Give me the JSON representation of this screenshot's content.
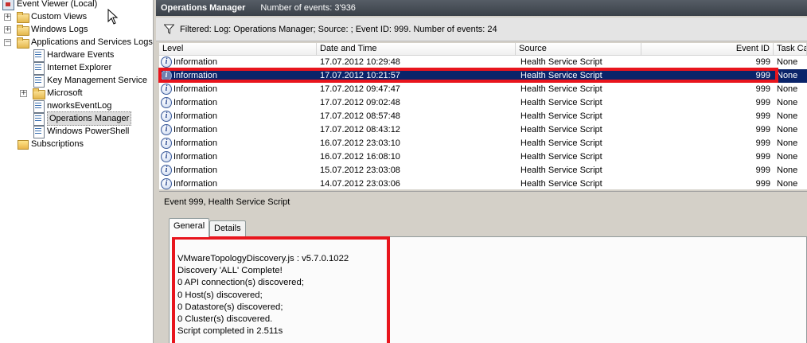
{
  "tree": {
    "root": "Event Viewer (Local)",
    "items": [
      {
        "label": "Custom Views",
        "icon": "folder-icon"
      },
      {
        "label": "Windows Logs",
        "icon": "folder-icon"
      },
      {
        "label": "Applications and Services Logs",
        "icon": "folder-icon"
      },
      {
        "label": "Hardware Events",
        "icon": "log-icon"
      },
      {
        "label": "Internet Explorer",
        "icon": "log-icon"
      },
      {
        "label": "Key Management Service",
        "icon": "log-icon"
      },
      {
        "label": "Microsoft",
        "icon": "folder-icon"
      },
      {
        "label": "nworksEventLog",
        "icon": "log-icon"
      },
      {
        "label": "Operations Manager",
        "icon": "log-icon"
      },
      {
        "label": "Windows PowerShell",
        "icon": "log-icon"
      },
      {
        "label": "Subscriptions",
        "icon": "subscriptions-icon"
      }
    ]
  },
  "header": {
    "title": "Operations Manager",
    "count": "Number of events: 3'936"
  },
  "filter": {
    "text": "Filtered: Log: Operations Manager; Source: ; Event ID: 999. Number of events: 24"
  },
  "grid": {
    "columns": [
      "Level",
      "Date and Time",
      "Source",
      "Event ID",
      "Task Ca"
    ],
    "rows": [
      {
        "level": "Information",
        "date": "17.07.2012 10:29:48",
        "source": "Health Service Script",
        "id": "999",
        "task": "None"
      },
      {
        "level": "Information",
        "date": "17.07.2012 10:21:57",
        "source": "Health Service Script",
        "id": "999",
        "task": "None"
      },
      {
        "level": "Information",
        "date": "17.07.2012 09:47:47",
        "source": "Health Service Script",
        "id": "999",
        "task": "None"
      },
      {
        "level": "Information",
        "date": "17.07.2012 09:02:48",
        "source": "Health Service Script",
        "id": "999",
        "task": "None"
      },
      {
        "level": "Information",
        "date": "17.07.2012 08:57:48",
        "source": "Health Service Script",
        "id": "999",
        "task": "None"
      },
      {
        "level": "Information",
        "date": "17.07.2012 08:43:12",
        "source": "Health Service Script",
        "id": "999",
        "task": "None"
      },
      {
        "level": "Information",
        "date": "16.07.2012 23:03:10",
        "source": "Health Service Script",
        "id": "999",
        "task": "None"
      },
      {
        "level": "Information",
        "date": "16.07.2012 16:08:10",
        "source": "Health Service Script",
        "id": "999",
        "task": "None"
      },
      {
        "level": "Information",
        "date": "15.07.2012 23:03:08",
        "source": "Health Service Script",
        "id": "999",
        "task": "None"
      },
      {
        "level": "Information",
        "date": "14.07.2012 23:03:06",
        "source": "Health Service Script",
        "id": "999",
        "task": "None"
      }
    ]
  },
  "detail": {
    "title": "Event 999, Health Service Script",
    "tabs": [
      "General",
      "Details"
    ],
    "message": [
      "VMwareTopologyDiscovery.js : v5.7.0.1022",
      "Discovery 'ALL' Complete!",
      "0 API connection(s) discovered;",
      "0 Host(s) discovered;",
      "0 Datastore(s) discovered;",
      "0 Cluster(s) discovered.",
      "Script completed in 2.511s"
    ]
  },
  "colors": {
    "selection": "#0a246a",
    "highlight": "#e8151d",
    "header_bg": "#3a4048"
  }
}
